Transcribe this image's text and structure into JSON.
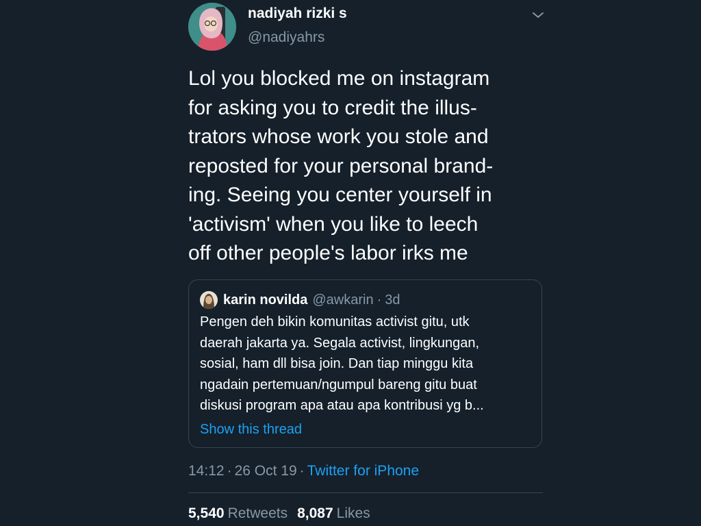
{
  "tweet": {
    "author": {
      "display_name": "nadiyah rizki s",
      "handle": "@nadiyahrs"
    },
    "text_lines": [
      "Lol you blocked me on instagram",
      "for asking you to credit the illus-",
      "trators whose work you stole and",
      "reposted for your personal brand-",
      "ing. Seeing you center yourself in",
      "'activism' when you like to leech",
      "off other people's labor irks me"
    ],
    "quoted": {
      "display_name": "karin novilda",
      "handle": "@awkarin",
      "separator": "·",
      "time": "3d",
      "text_lines": [
        "Pengen deh bikin komunitas activist gitu, utk",
        "daerah jakarta ya. Segala activist, lingkungan,",
        "sosial, ham dll bisa join. Dan tiap minggu kita",
        "ngadain pertemuan/ngumpul bareng gitu buat",
        "diskusi program apa atau apa kontribusi yg b..."
      ],
      "show_thread_label": "Show this thread"
    },
    "meta": {
      "time": "14:12",
      "separator": "·",
      "date": "26 Oct 19",
      "source": "Twitter for iPhone"
    },
    "stats": {
      "retweets_count": "5,540",
      "retweets_label": "Retweets",
      "likes_count": "8,087",
      "likes_label": "Likes"
    }
  },
  "icons": {
    "more": "chevron-down-icon"
  },
  "colors": {
    "background": "#15202b",
    "text_primary": "#ffffff",
    "text_secondary": "#8899a6",
    "accent": "#1da1f2",
    "border": "#38444d"
  }
}
